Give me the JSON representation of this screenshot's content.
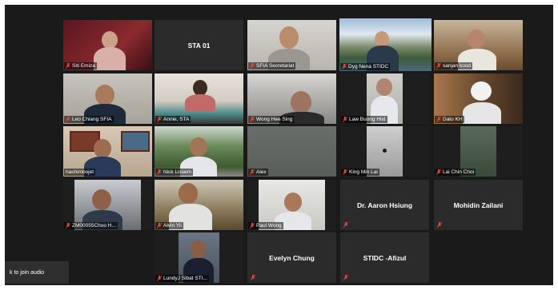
{
  "participants": [
    {
      "name": "Siti Emiza",
      "video": true
    },
    {
      "name": "STA 01",
      "video": false
    },
    {
      "name": "SFIA Secretariat",
      "video": true
    },
    {
      "name": "Dyg Nena STIDC",
      "video": true,
      "speaking": true
    },
    {
      "name": "sanjan kood",
      "video": true
    },
    {
      "name": "Leo Chiang SFIA",
      "video": true
    },
    {
      "name": "Annie, STA",
      "video": true
    },
    {
      "name": "Wong Hee Sing",
      "video": true
    },
    {
      "name": "Law Buong Hiid",
      "video": true
    },
    {
      "name": "Dato KH",
      "video": true
    },
    {
      "name": "hashimbojet",
      "video": true
    },
    {
      "name": "Nick Lissem",
      "video": true
    },
    {
      "name": "Alex",
      "video": true
    },
    {
      "name": "King Min Lai",
      "video": true
    },
    {
      "name": "Lai Chin Choi",
      "video": true
    },
    {
      "name": "ZM00055Choo H...",
      "video": true
    },
    {
      "name": "Alvin Yii",
      "video": true
    },
    {
      "name": "Paul Wong",
      "video": true
    },
    {
      "name": "Dr. Aaron Hsiung",
      "video": false
    },
    {
      "name": "Mohidin Zailani",
      "video": false
    },
    {
      "name": "LundyJ Sibat STI...",
      "video": true
    },
    {
      "name": "Evelyn Chung",
      "video": false
    },
    {
      "name": "STIDC -Afizul",
      "video": false
    }
  ],
  "audio_toast": "k to join audio",
  "colors": {
    "speaking_border": "#e2ec3e",
    "mic_muted": "#e0453a"
  }
}
